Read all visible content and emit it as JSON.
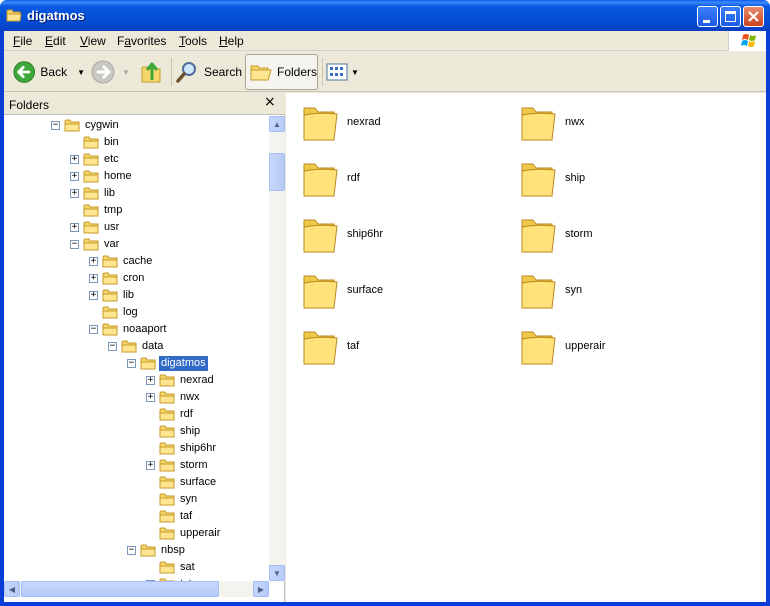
{
  "window": {
    "title": "digatmos"
  },
  "menu": {
    "file": "File",
    "file_key": "F",
    "file_rest": "ile",
    "edit_key": "E",
    "edit_rest": "dit",
    "view_key": "V",
    "view_rest": "iew",
    "favorites_pre": "F",
    "favorites_key": "a",
    "favorites_rest": "vorites",
    "tools_key": "T",
    "tools_rest": "ools",
    "help_key": "H",
    "help_rest": "elp"
  },
  "toolbar": {
    "back_label": "Back",
    "search_label": "Search",
    "folders_label": "Folders"
  },
  "folders_pane": {
    "title": "Folders",
    "close_glyph": "×",
    "tree": [
      {
        "label": "cygwin",
        "exp": "−",
        "level": 0
      },
      {
        "label": "bin",
        "exp": "",
        "level": 1
      },
      {
        "label": "etc",
        "exp": "+",
        "level": 1
      },
      {
        "label": "home",
        "exp": "+",
        "level": 1
      },
      {
        "label": "lib",
        "exp": "+",
        "level": 1
      },
      {
        "label": "tmp",
        "exp": "",
        "level": 1
      },
      {
        "label": "usr",
        "exp": "+",
        "level": 1
      },
      {
        "label": "var",
        "exp": "−",
        "level": 1
      },
      {
        "label": "cache",
        "exp": "+",
        "level": 2
      },
      {
        "label": "cron",
        "exp": "+",
        "level": 2
      },
      {
        "label": "lib",
        "exp": "+",
        "level": 2
      },
      {
        "label": "log",
        "exp": "",
        "level": 2
      },
      {
        "label": "noaaport",
        "exp": "−",
        "level": 2
      },
      {
        "label": "data",
        "exp": "−",
        "level": 3
      },
      {
        "label": "digatmos",
        "exp": "−",
        "level": 4,
        "selected": true
      },
      {
        "label": "nexrad",
        "exp": "+",
        "level": 5
      },
      {
        "label": "nwx",
        "exp": "+",
        "level": 5
      },
      {
        "label": "rdf",
        "exp": "",
        "level": 5
      },
      {
        "label": "ship",
        "exp": "",
        "level": 5
      },
      {
        "label": "ship6hr",
        "exp": "",
        "level": 5
      },
      {
        "label": "storm",
        "exp": "+",
        "level": 5
      },
      {
        "label": "surface",
        "exp": "",
        "level": 5
      },
      {
        "label": "syn",
        "exp": "",
        "level": 5
      },
      {
        "label": "taf",
        "exp": "",
        "level": 5
      },
      {
        "label": "upperair",
        "exp": "",
        "level": 5
      },
      {
        "label": "nbsp",
        "exp": "−",
        "level": 4
      },
      {
        "label": "sat",
        "exp": "",
        "level": 5
      },
      {
        "label": "txt",
        "exp": "−",
        "level": 5
      }
    ]
  },
  "content": {
    "items": [
      "nexrad",
      "nwx",
      "rdf",
      "ship",
      "ship6hr",
      "storm",
      "surface",
      "syn",
      "taf",
      "upperair"
    ]
  },
  "colors": {
    "title_blue": "#0a3cd6",
    "selection": "#316ac5",
    "folder_yellow": "#f7d66b"
  }
}
